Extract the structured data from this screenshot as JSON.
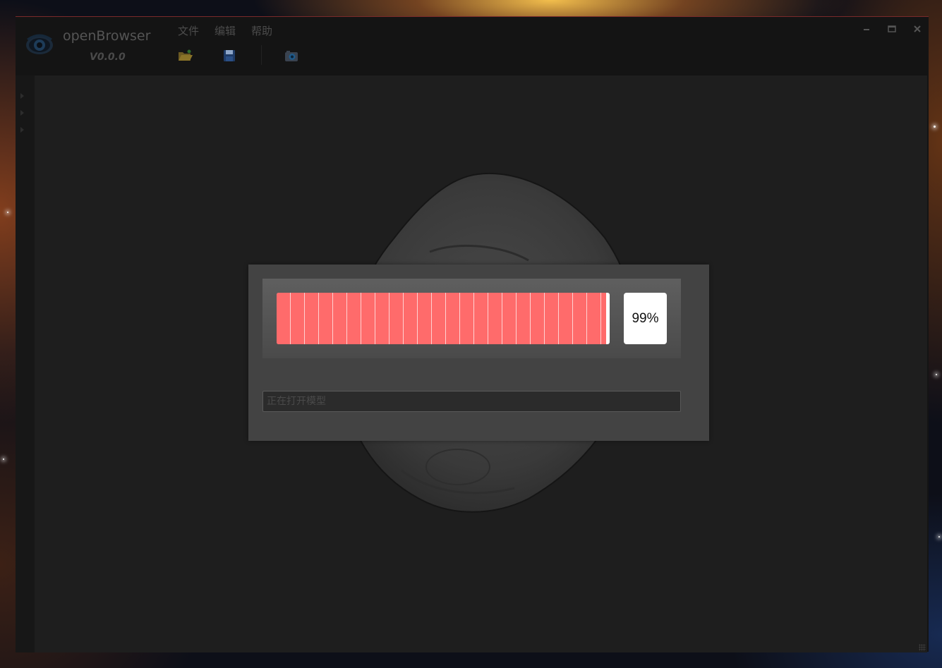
{
  "app": {
    "name": "openBrowser",
    "version": "V0.0.0"
  },
  "menu": [
    {
      "label": "文件"
    },
    {
      "label": "编辑"
    },
    {
      "label": "帮助"
    }
  ],
  "toolbar": [
    {
      "icon": "folder-open-icon"
    },
    {
      "icon": "save-icon"
    },
    {
      "icon": "camera-icon"
    }
  ],
  "window_controls": [
    {
      "icon": "minimize-icon"
    },
    {
      "icon": "maximize-icon"
    },
    {
      "icon": "close-icon"
    }
  ],
  "progress": {
    "value": 0.99,
    "label": "99%",
    "fill_color": "#ff6b6b"
  },
  "status": {
    "text": "正在打开模型"
  },
  "colors": {
    "window_bg": "#141414",
    "viewport_bg": "#1e1e1e",
    "dialog_bg": "#434343",
    "accent_red": "#ff6b6b"
  }
}
